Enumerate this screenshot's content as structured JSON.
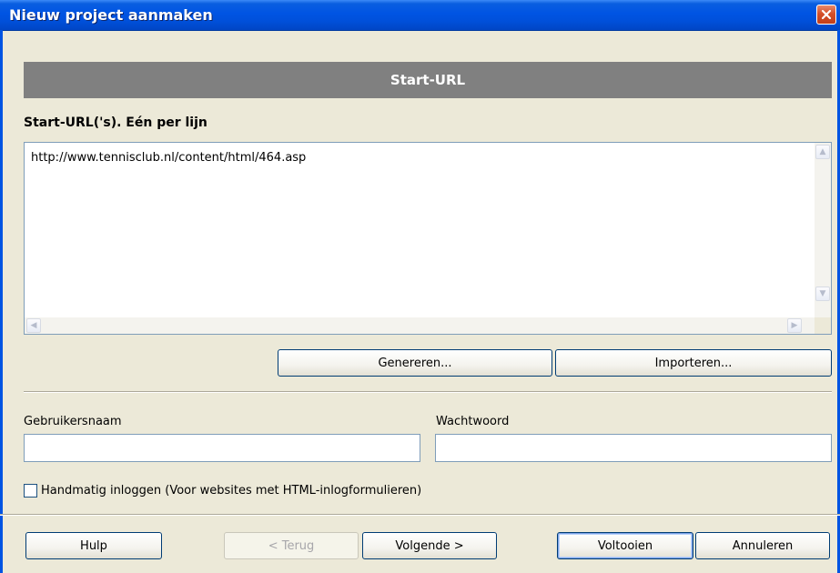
{
  "window": {
    "title": "Nieuw project aanmaken"
  },
  "header": {
    "title": "Start-URL"
  },
  "urls": {
    "label": "Start-URL('s). Eén per lijn",
    "value": "http://www.tennisclub.nl/content/html/464.asp"
  },
  "actions": {
    "generate_label": "Genereren...",
    "import_label": "Importeren..."
  },
  "credentials": {
    "username_label": "Gebruikersnaam",
    "username_value": "",
    "password_label": "Wachtwoord",
    "password_value": ""
  },
  "manual_login": {
    "label": "Handmatig inloggen (Voor websites met HTML-inlogformulieren)",
    "checked": false
  },
  "footer": {
    "help_label": "Hulp",
    "back_label": "< Terug",
    "next_label": "Volgende >",
    "finish_label": "Voltooien",
    "cancel_label": "Annuleren"
  },
  "colors": {
    "titlebar": "#0054e3",
    "header_band": "#808080",
    "dialog_background": "#ece9d8",
    "close_button": "#d5502a"
  },
  "icons": {
    "close": "close-icon",
    "scroll_up": "scroll-up-icon",
    "scroll_down": "scroll-down-icon",
    "scroll_left": "scroll-left-icon",
    "scroll_right": "scroll-right-icon"
  }
}
